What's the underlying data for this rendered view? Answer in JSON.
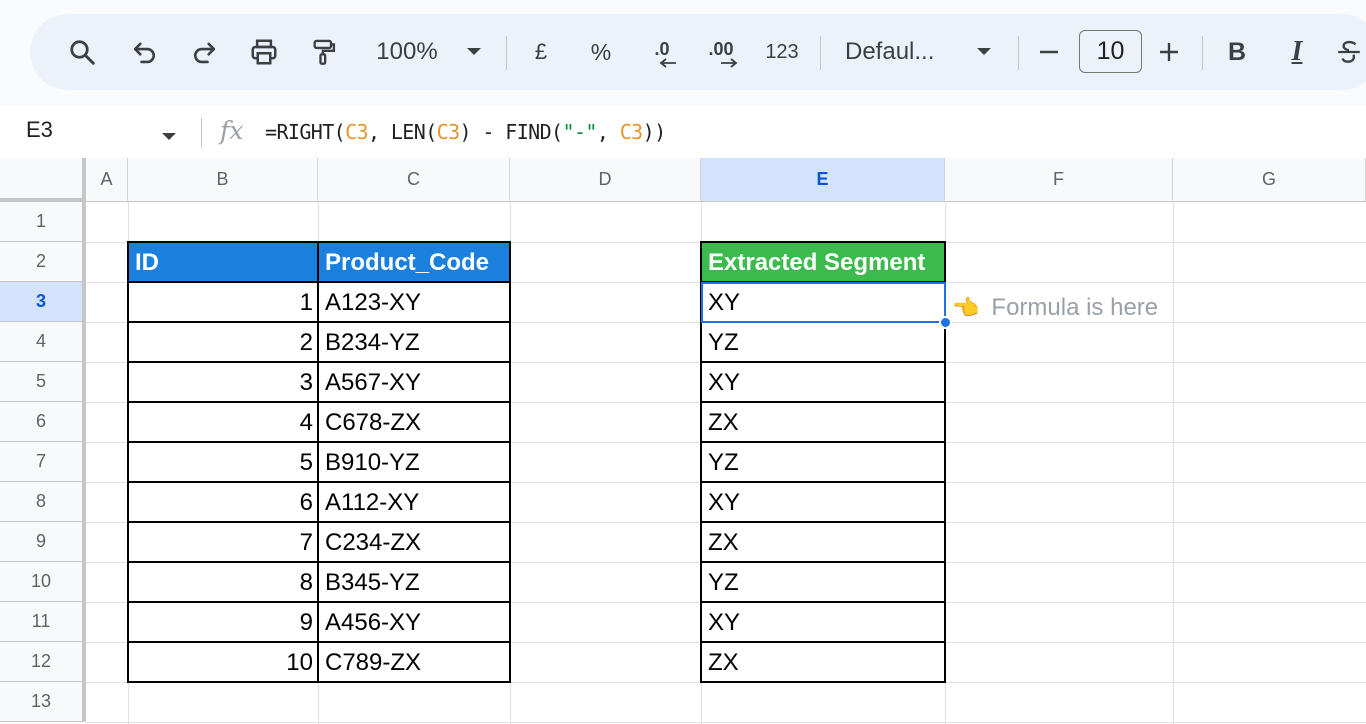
{
  "toolbar": {
    "zoom": "100%",
    "currency": "£",
    "percent": "%",
    "dec_decrease": ".0",
    "dec_increase": ".00",
    "number_format": "123",
    "font_name": "Defaul...",
    "font_size": "10",
    "bold": "B",
    "italic": "I"
  },
  "formula_bar": {
    "cell_ref": "E3",
    "fx": "fx",
    "formula_parts": [
      {
        "text": "=RIGHT(",
        "kind": "plain"
      },
      {
        "text": "C3",
        "kind": "ref"
      },
      {
        "text": ", LEN(",
        "kind": "plain"
      },
      {
        "text": "C3",
        "kind": "ref"
      },
      {
        "text": ") - FIND(",
        "kind": "plain"
      },
      {
        "text": "\"-\"",
        "kind": "str"
      },
      {
        "text": ", ",
        "kind": "plain"
      },
      {
        "text": "C3",
        "kind": "ref"
      },
      {
        "text": "))",
        "kind": "plain"
      }
    ]
  },
  "columns": [
    "A",
    "B",
    "C",
    "D",
    "E",
    "F",
    "G"
  ],
  "selected_column": "E",
  "rows": [
    "1",
    "2",
    "3",
    "4",
    "5",
    "6",
    "7",
    "8",
    "9",
    "10",
    "11",
    "12",
    "13"
  ],
  "selected_row": "3",
  "table": {
    "headers": {
      "id": "ID",
      "code": "Product_Code",
      "segment": "Extracted Segment"
    },
    "header_colors": {
      "id_code": "#1b7fdd",
      "segment": "#3dba4e"
    },
    "ids": [
      "1",
      "2",
      "3",
      "4",
      "5",
      "6",
      "7",
      "8",
      "9",
      "10"
    ],
    "codes": [
      "A123-XY",
      "B234-YZ",
      "A567-XY",
      "C678-ZX",
      "B910-YZ",
      "A112-XY",
      "C234-ZX",
      "B345-YZ",
      "A456-XY",
      "C789-ZX"
    ],
    "segments": [
      "XY",
      "YZ",
      "XY",
      "ZX",
      "YZ",
      "XY",
      "ZX",
      "YZ",
      "XY",
      "ZX"
    ]
  },
  "note": {
    "icon": "pointing-hand-icon",
    "text": "Formula is here"
  },
  "accent_color": "#1a73e8"
}
